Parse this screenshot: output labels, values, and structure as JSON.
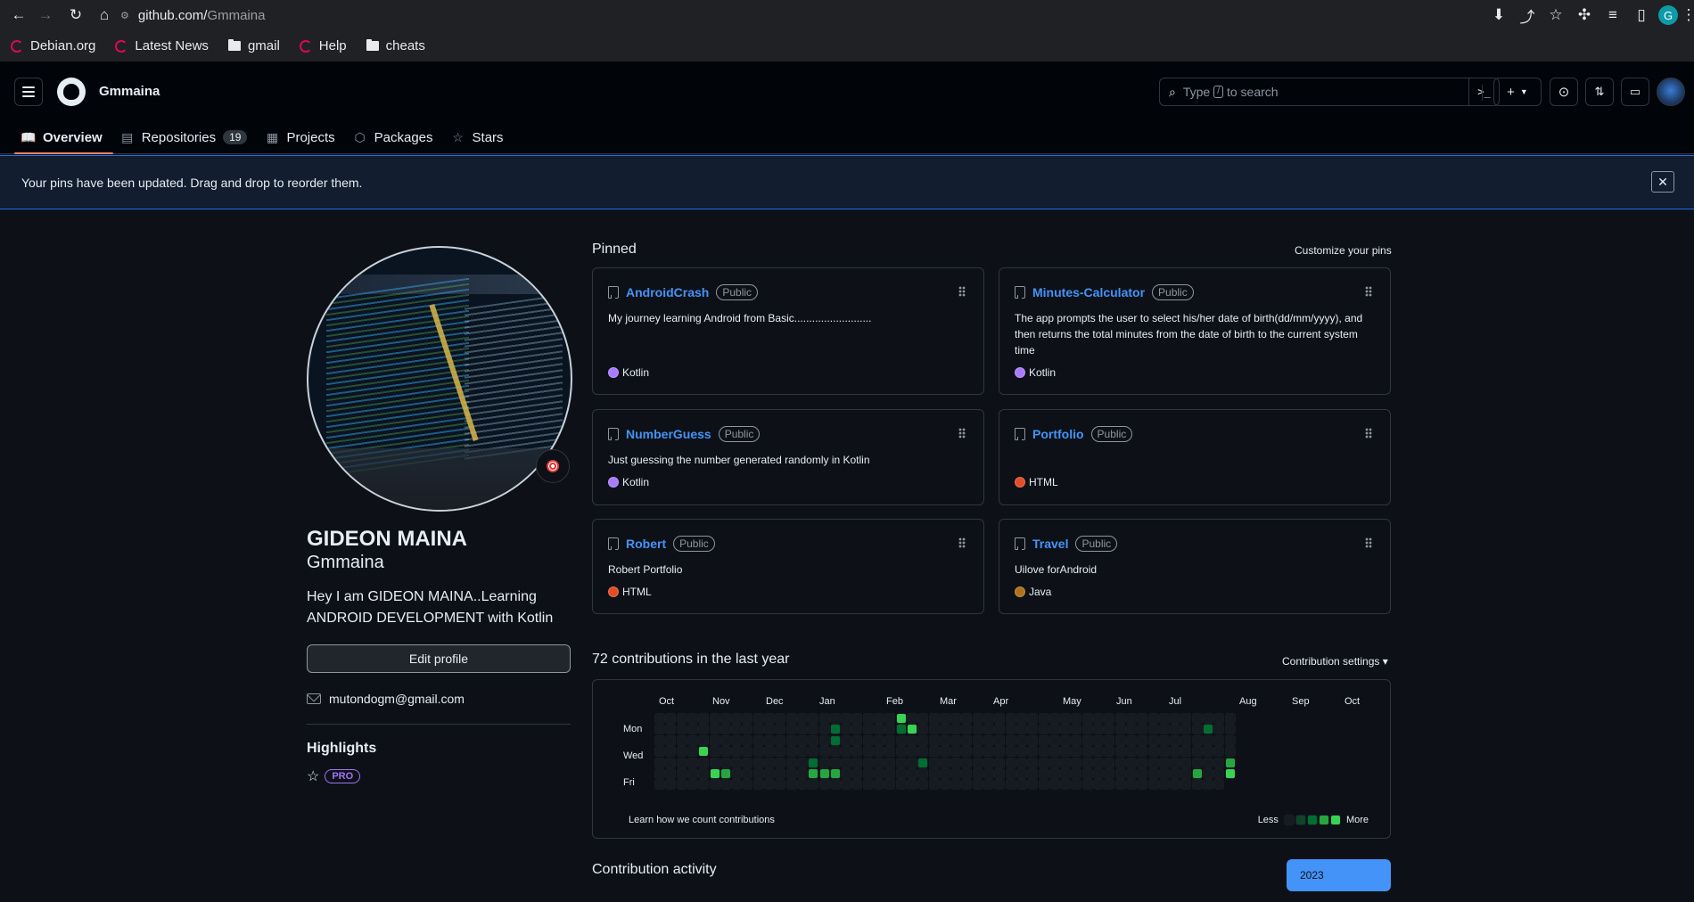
{
  "browser": {
    "url_host": "github.com/",
    "url_path": "Gmmaina",
    "profile_initial": "G",
    "bookmarks": [
      {
        "label": "Debian.org",
        "icon": "debian-icon"
      },
      {
        "label": "Latest News",
        "icon": "debian-icon"
      },
      {
        "label": "gmail",
        "icon": "folder-icon"
      },
      {
        "label": "Help",
        "icon": "debian-icon"
      },
      {
        "label": "cheats",
        "icon": "folder-icon"
      }
    ]
  },
  "header": {
    "username": "Gmmaina",
    "search_prefix": "Type",
    "search_key": "/",
    "search_suffix": "to search",
    "command_icon": ">_",
    "create_icon": "+",
    "tabs": [
      {
        "label": "Overview",
        "icon": "book-icon",
        "active": true
      },
      {
        "label": "Repositories",
        "icon": "repo-icon",
        "count": "19"
      },
      {
        "label": "Projects",
        "icon": "table-icon"
      },
      {
        "label": "Packages",
        "icon": "package-icon"
      },
      {
        "label": "Stars",
        "icon": "star-icon"
      }
    ]
  },
  "flash": {
    "message": "Your pins have been updated. Drag and drop to reorder them.",
    "close": "✕"
  },
  "profile": {
    "name": "GIDEON MAINA",
    "login": "Gmmaina",
    "bio": "Hey I am GIDEON MAINA..Learning ANDROID DEVELOPMENT with Kotlin",
    "edit_label": "Edit profile",
    "email": "mutondogm@gmail.com",
    "highlights_title": "Highlights",
    "pro_label": "PRO"
  },
  "pinned": {
    "title": "Pinned",
    "customize": "Customize your pins",
    "public_label": "Public",
    "repos": [
      {
        "name": "AndroidCrash",
        "desc": "My journey learning Android from Basic..........................",
        "lang": "Kotlin",
        "color": "#a97bff"
      },
      {
        "name": "Minutes-Calculator",
        "desc": "The app prompts the user to select his/her date of birth(dd/mm/yyyy), and then returns the total minutes from the date of birth to the current system time",
        "lang": "Kotlin",
        "color": "#a97bff"
      },
      {
        "name": "NumberGuess",
        "desc": "Just guessing the number generated randomly in Kotlin",
        "lang": "Kotlin",
        "color": "#a97bff"
      },
      {
        "name": "Portfolio",
        "desc": "",
        "lang": "HTML",
        "color": "#e34c26"
      },
      {
        "name": "Robert",
        "desc": "Robert Portfolio",
        "lang": "HTML",
        "color": "#e34c26"
      },
      {
        "name": "Travel",
        "desc": "Uilove forAndroid",
        "lang": "Java",
        "color": "#b07219"
      }
    ]
  },
  "contributions": {
    "title": "72 contributions in the last year",
    "settings": "Contribution settings ▾",
    "months": [
      "Oct",
      "Nov",
      "Dec",
      "Jan",
      "Feb",
      "Mar",
      "Apr",
      "May",
      "Jun",
      "Jul",
      "Aug",
      "Sep",
      "Oct"
    ],
    "days": [
      "Mon",
      "Wed",
      "Fri"
    ],
    "learn": "Learn how we count contributions",
    "less": "Less",
    "more": "More",
    "levels": [
      "#161b22",
      "#0e4429",
      "#006d32",
      "#26a641",
      "#39d353"
    ],
    "active_cells": [
      {
        "week": 4,
        "day": 3,
        "level": 4
      },
      {
        "week": 5,
        "day": 5,
        "level": 4
      },
      {
        "week": 6,
        "day": 5,
        "level": 3
      },
      {
        "week": 14,
        "day": 4,
        "level": 2
      },
      {
        "week": 14,
        "day": 5,
        "level": 3
      },
      {
        "week": 15,
        "day": 5,
        "level": 3
      },
      {
        "week": 16,
        "day": 1,
        "level": 2
      },
      {
        "week": 16,
        "day": 2,
        "level": 2
      },
      {
        "week": 16,
        "day": 5,
        "level": 3
      },
      {
        "week": 22,
        "day": 0,
        "level": 4
      },
      {
        "week": 22,
        "day": 1,
        "level": 2
      },
      {
        "week": 23,
        "day": 1,
        "level": 4
      },
      {
        "week": 24,
        "day": 4,
        "level": 2
      },
      {
        "week": 49,
        "day": 5,
        "level": 3
      },
      {
        "week": 50,
        "day": 1,
        "level": 2
      },
      {
        "week": 52,
        "day": 4,
        "level": 3
      },
      {
        "week": 52,
        "day": 5,
        "level": 4
      }
    ]
  },
  "activity": {
    "title": "Contribution activity",
    "year": "2023"
  }
}
